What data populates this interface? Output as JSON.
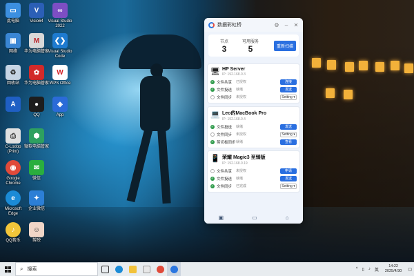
{
  "desktop": {
    "icons": [
      {
        "label": "此电脑",
        "icon": "computer-icon"
      },
      {
        "label": "Visio64",
        "icon": "visio-icon"
      },
      {
        "label": "Visual Studio 2022",
        "icon": "visual-studio-icon"
      },
      {
        "label": "网络",
        "icon": "network-icon"
      },
      {
        "label": "华为电脑管家",
        "icon": "huawei-manager-icon"
      },
      {
        "label": "Visual Studio Code",
        "icon": "vscode-icon"
      },
      {
        "label": "回收站",
        "icon": "recycle-bin-icon"
      },
      {
        "label": "华为电脑管家",
        "icon": "huawei-icon"
      },
      {
        "label": "WPS Office",
        "icon": "wps-icon"
      },
      {
        "label": "A",
        "icon": "app-a-icon"
      },
      {
        "label": "QQ",
        "icon": "qq-icon"
      },
      {
        "label": "App",
        "icon": "app-icon"
      },
      {
        "label": "C-Lodop (Print)",
        "icon": "printer-icon"
      },
      {
        "label": "微软电脑管家",
        "icon": "pc-manager-icon"
      },
      {
        "label": "Google Chrome",
        "icon": "chrome-icon"
      },
      {
        "label": "微信",
        "icon": "wechat-icon"
      },
      {
        "label": "Microsoft Edge",
        "icon": "edge-icon"
      },
      {
        "label": "企业微信",
        "icon": "wecom-icon"
      },
      {
        "label": "QQ音乐",
        "icon": "qqmusic-icon"
      },
      {
        "label": "剪映",
        "icon": "jianying-icon"
      }
    ]
  },
  "app": {
    "title": "数据彩虹桥",
    "stats": {
      "nodes_label": "节点",
      "nodes_value": "3",
      "services_label": "可用服务",
      "services_value": "5",
      "rescan_label": "重新扫描"
    },
    "devices": [
      {
        "name": "HP Server",
        "ip": "IP: 192.168.0.3",
        "icon": "desktop-icon",
        "rows": [
          {
            "label": "文件共享",
            "status": "已授权",
            "on": true,
            "action": "连接",
            "kind": "button"
          },
          {
            "label": "文件投送",
            "status": "就绪",
            "on": true,
            "action": "发送",
            "kind": "button"
          },
          {
            "label": "文件同步",
            "status": "未授权",
            "on": false,
            "action": "Setting",
            "kind": "select"
          }
        ]
      },
      {
        "name": "Leo的MacBook Pro",
        "ip": "IP: 192.168.0.4",
        "icon": "laptop-icon",
        "rows": [
          {
            "label": "文件投送",
            "status": "就绪",
            "on": true,
            "action": "发送",
            "kind": "button"
          },
          {
            "label": "文件同步",
            "status": "未授权",
            "on": false,
            "action": "Setting",
            "kind": "select"
          },
          {
            "label": "剪切板同步",
            "status": "就绪",
            "on": true,
            "action": "查看",
            "kind": "button"
          }
        ]
      },
      {
        "name": "荣耀 Magic3 至臻版",
        "ip": "IP: 192.168.0.19",
        "icon": "phone-icon",
        "rows": [
          {
            "label": "文件共享",
            "status": "未授权",
            "on": false,
            "action": "申请",
            "kind": "button"
          },
          {
            "label": "文件投送",
            "status": "就绪",
            "on": true,
            "action": "发送",
            "kind": "button"
          },
          {
            "label": "文件同步",
            "status": "已完成",
            "on": true,
            "action": "Setting",
            "kind": "select"
          }
        ]
      }
    ]
  },
  "taskbar": {
    "search_placeholder": "搜索",
    "ime": "英",
    "time": "14:22",
    "date": "2025/4/30"
  }
}
